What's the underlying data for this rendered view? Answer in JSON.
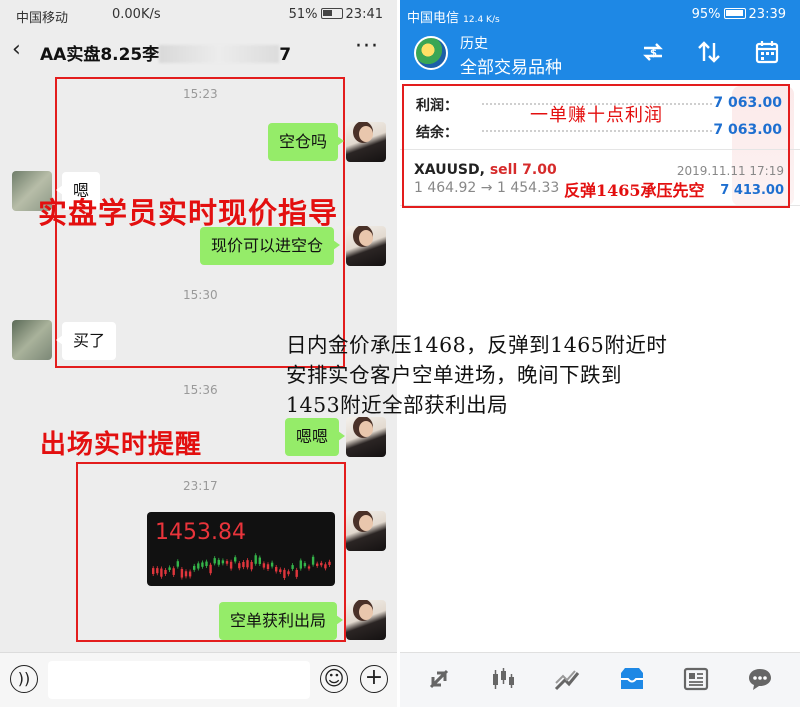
{
  "left": {
    "status": {
      "carrier": "中国移动",
      "signal": "4G",
      "speed": "0.00K/s",
      "battery": "51%",
      "time": "23:41"
    },
    "header": {
      "back_icon": "chevron-left-icon",
      "title": "AA实盘8.25李",
      "title_suffix": "7",
      "more_icon": "more-dots-icon",
      "more_text": "···"
    },
    "messages": [
      {
        "type": "time",
        "text": "15:23"
      },
      {
        "type": "out",
        "text": "空仓吗"
      },
      {
        "type": "in",
        "text": "嗯"
      },
      {
        "type": "out",
        "text": "现价可以进空仓"
      },
      {
        "type": "time",
        "text": "15:30"
      },
      {
        "type": "in",
        "text": "买了"
      },
      {
        "type": "time",
        "text": "15:36"
      },
      {
        "type": "out",
        "text": "嗯嗯"
      },
      {
        "type": "time",
        "text": "23:17"
      },
      {
        "type": "out-image",
        "text": "1453.84"
      },
      {
        "type": "out",
        "text": "空单获利出局"
      }
    ],
    "overlays": {
      "guide": "实盘学员实时现价指导",
      "exit": "出场实时提醒"
    },
    "input": {
      "voice_icon": "voice-icon",
      "voice_text": "))",
      "emoji_icon": "emoji-icon",
      "emoji_text": "☺",
      "add_icon": "plus-icon",
      "add_text": "+"
    }
  },
  "right": {
    "status": {
      "carrier": "中国电信",
      "speed": "12.4 K/s",
      "battery": "95%",
      "time": "23:39"
    },
    "appbar": {
      "subtitle": "历史",
      "title": "全部交易品种",
      "icons": [
        "currency-swap-icon",
        "sort-arrows-icon",
        "calendar-icon"
      ]
    },
    "summary": {
      "profit_label": "利润：",
      "profit_value": "7 063.00",
      "balance_label": "结余：",
      "balance_value": "7 063.00",
      "annotation": "一单赚十点利润"
    },
    "trade": {
      "symbol": "XAUUSD,",
      "side": "sell 7.00",
      "datetime": "2019.11.11 17:19",
      "open_price": "1 464.92",
      "arrow": "→",
      "close_price": "1 454.33",
      "profit": "7 413.00",
      "annotation": "反弹1465承压先空"
    },
    "bottom_nav": [
      {
        "name": "quotes-icon",
        "glyph": "⇅",
        "active": false
      },
      {
        "name": "chart-icon",
        "glyph": "⫶",
        "active": false
      },
      {
        "name": "trade-icon",
        "glyph": "⟋",
        "active": false
      },
      {
        "name": "history-icon",
        "glyph": "▭",
        "active": true
      },
      {
        "name": "news-icon",
        "glyph": "▤",
        "active": false
      },
      {
        "name": "chat-icon",
        "glyph": "●",
        "active": false
      }
    ]
  },
  "note": {
    "line1": "日内金价承压1468，反弹到1465附近时",
    "line2": "安排实仓客户空单进场，晚间下跌到",
    "line3": "1453附近全部获利出局"
  },
  "colors": {
    "wechat_green": "#95ec69",
    "app_blue": "#1e88e5",
    "annotation_red": "#e30f0f",
    "profit_blue": "#1e6fd0"
  }
}
